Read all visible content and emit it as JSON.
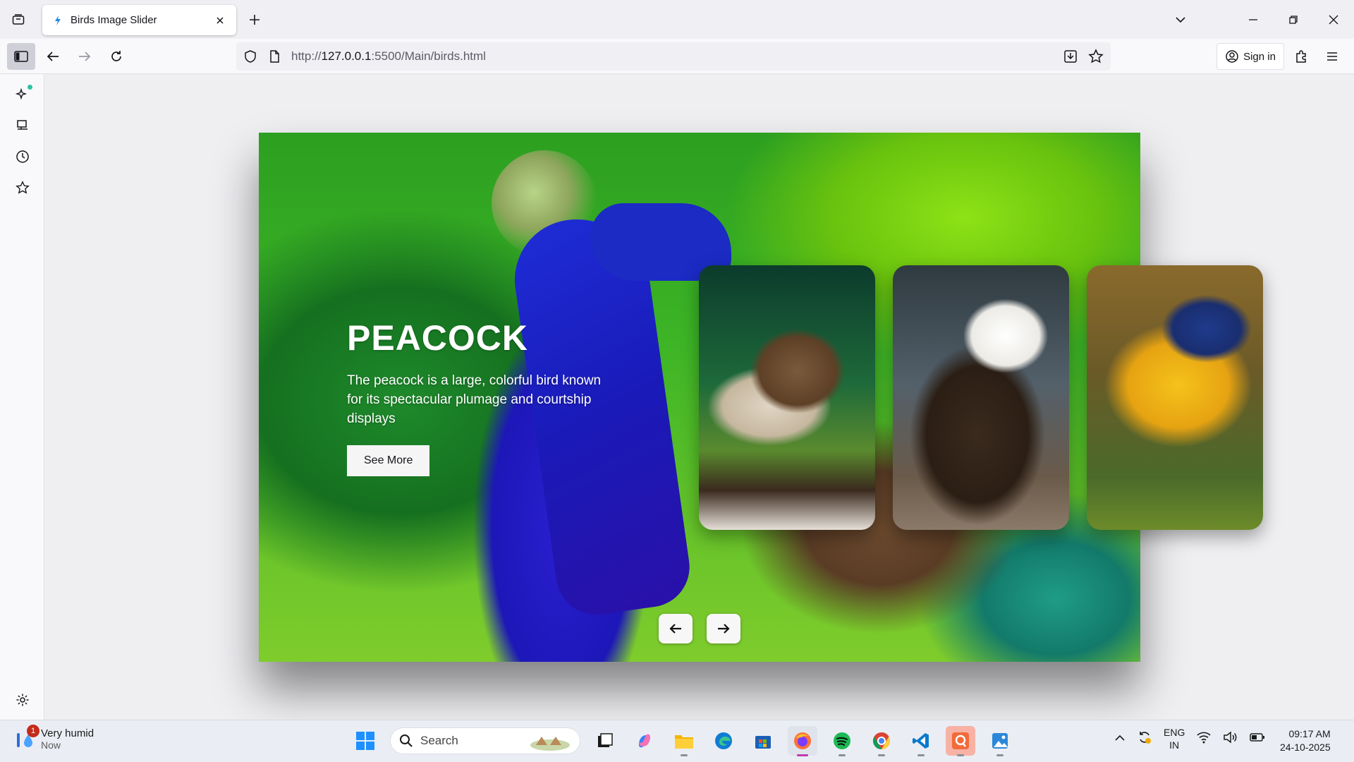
{
  "browser": {
    "tab_title": "Birds Image Slider",
    "url_prefix": "http://",
    "url_host": "127.0.0.1",
    "url_rest": ":5500/Main/birds.html",
    "sign_in_label": "Sign in"
  },
  "hero": {
    "title": "PEACOCK",
    "description": "The peacock is a large, colorful bird known for its spectacular plumage and courtship displays",
    "button_label": "See More"
  },
  "thumbnails": [
    {
      "name": "sparrow"
    },
    {
      "name": "eagle"
    },
    {
      "name": "parrot"
    }
  ],
  "taskbar": {
    "weather_text": "Very humid",
    "weather_time": "Now",
    "notification_count": "1",
    "search_placeholder": "Search",
    "lang_line1": "ENG",
    "lang_line2": "IN",
    "time": "09:17 AM",
    "date": "24-10-2025"
  },
  "colors": {
    "accent_firefox": "#c239b3",
    "sidebar_dot": "#2ac3a2"
  }
}
